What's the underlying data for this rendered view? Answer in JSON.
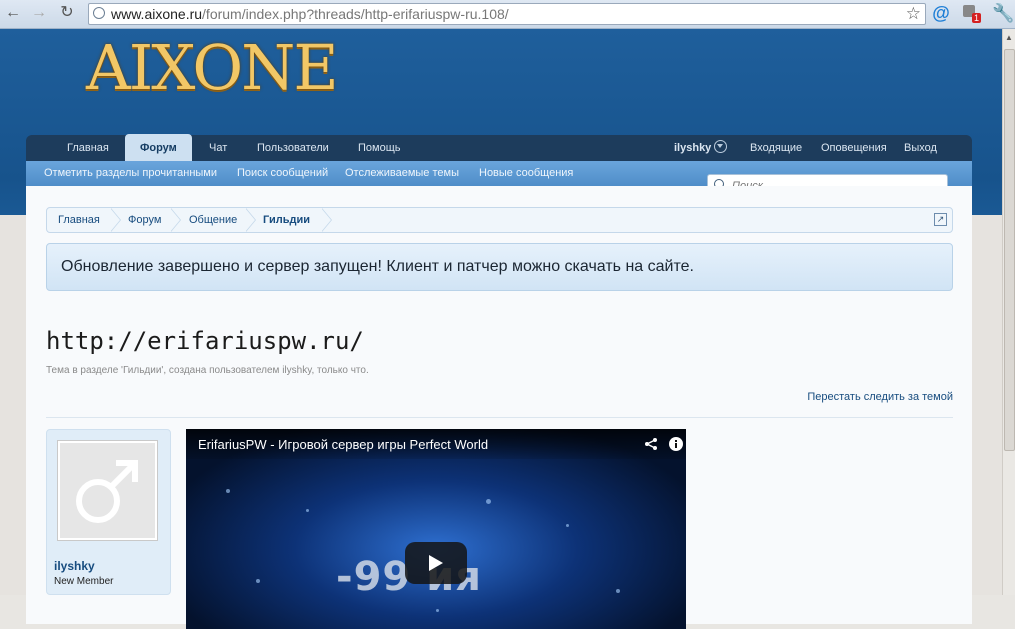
{
  "browser": {
    "url_host": "www.aixone.ru",
    "url_path": "/forum/index.php?threads/http-erifariuspw-ru.108/",
    "extension_badge": "1"
  },
  "site": {
    "logo_text": "AIXONE",
    "nav": {
      "tabs": [
        "Главная",
        "Форум",
        "Чат",
        "Пользователи",
        "Помощь"
      ],
      "active_tab": "Форум",
      "username": "ilyshky",
      "inbox": "Входящие",
      "alerts": "Оповещения",
      "logout": "Выход"
    },
    "subnav": [
      "Отметить разделы прочитанными",
      "Поиск сообщений",
      "Отслеживаемые темы",
      "Новые сообщения"
    ],
    "search": {
      "placeholder": "Поиск..."
    }
  },
  "breadcrumb": [
    "Главная",
    "Форум",
    "Общение",
    "Гильдии"
  ],
  "notice": "Обновление завершено и сервер запущен! Клиент и патчер можно скачать на сайте.",
  "thread": {
    "title": "http://erifariuspw.ru/",
    "meta": "Тема в разделе 'Гильдии', создана пользователем ilyshky, только что.",
    "unwatch_label": "Перестать следить за темой"
  },
  "post": {
    "author": "ilyshky",
    "author_role": "New Member",
    "video_title": "ErifariusPW - Игровой сервер игры Perfect World",
    "video_overlay": "-99 ия"
  },
  "colors": {
    "header_bg": "#1a5994",
    "nav_bg": "#1d3c5c",
    "subnav_bg": "#5d9ad3",
    "link": "#174c7f",
    "logo_gold": "#f2c766"
  }
}
